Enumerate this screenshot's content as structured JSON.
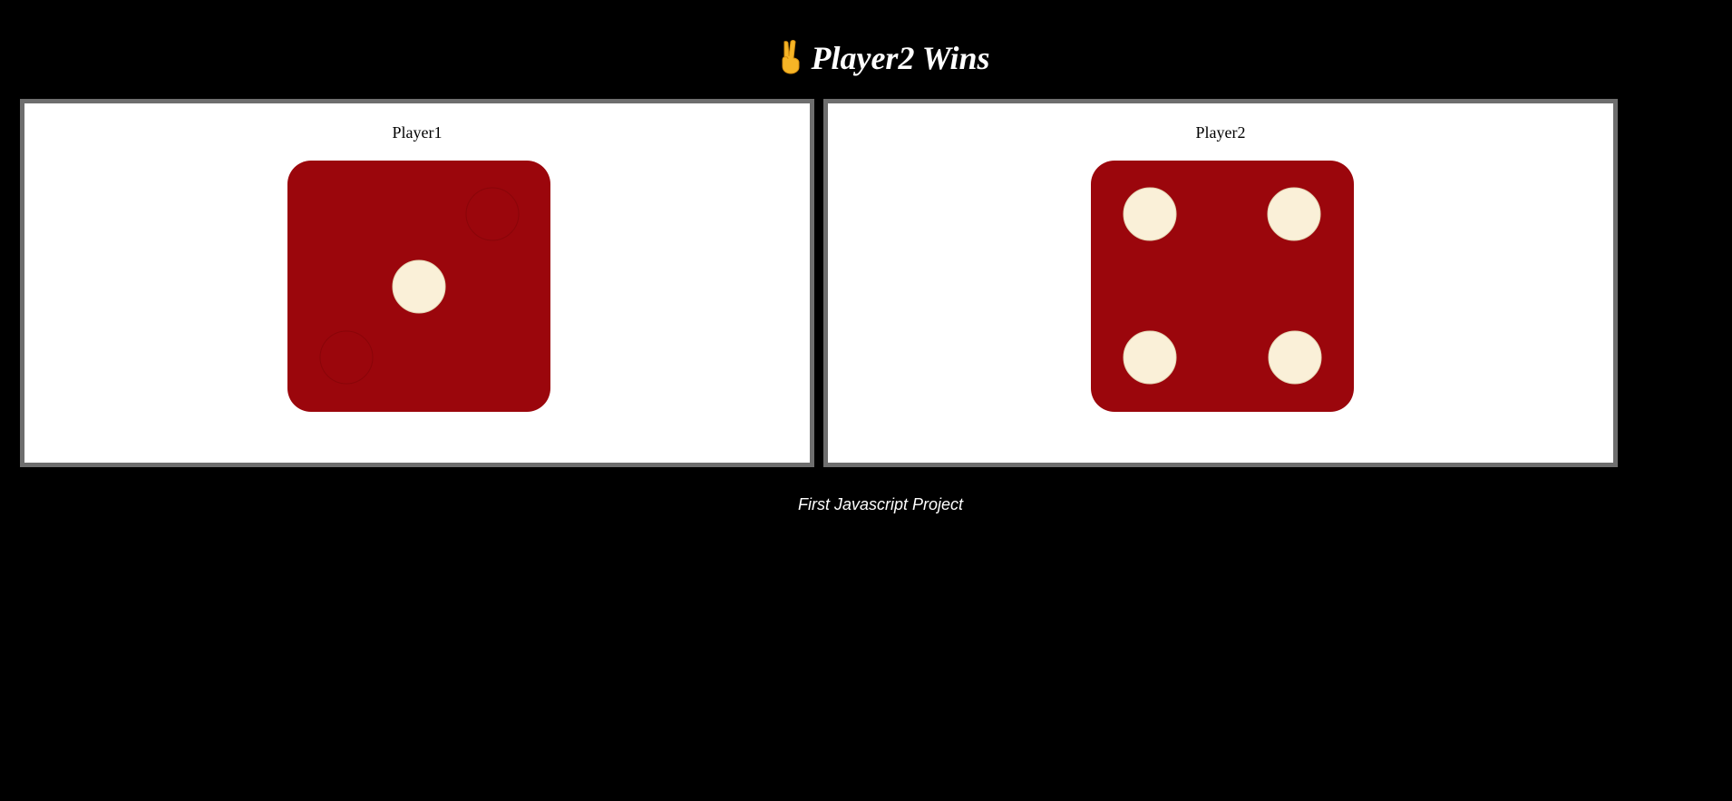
{
  "header": {
    "icon": "victory-hand-icon",
    "title": "Player2 Wins"
  },
  "players": [
    {
      "name": "Player1",
      "die_value": 1
    },
    {
      "name": "Player2",
      "die_value": 4
    }
  ],
  "footer": {
    "text": "First Javascript Project"
  },
  "colors": {
    "background": "#000000",
    "panel": "#ffffff",
    "panel_border": "#6e6e6e",
    "die_face": "#9b060c",
    "pip": "#faf0d8",
    "pip_hidden_outline": "#8a0509"
  }
}
